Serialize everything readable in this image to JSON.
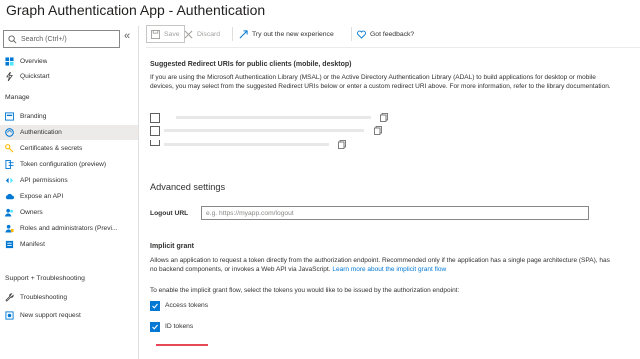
{
  "app": {
    "title": "Graph Authentication App - Authentication"
  },
  "sidebar": {
    "search_placeholder": "Search (Ctrl+/)",
    "collapse_glyph": "«",
    "top_items": [
      {
        "label": "Overview",
        "icon": "grid-icon"
      },
      {
        "label": "Quickstart",
        "icon": "lightning-icon"
      }
    ],
    "manage_heading": "Manage",
    "manage_items": [
      {
        "label": "Branding",
        "icon": "branding-icon"
      },
      {
        "label": "Authentication",
        "icon": "auth-icon",
        "active": true
      },
      {
        "label": "Certificates & secrets",
        "icon": "key-icon"
      },
      {
        "label": "Token configuration (preview)",
        "icon": "token-icon"
      },
      {
        "label": "API permissions",
        "icon": "api-permissions-icon"
      },
      {
        "label": "Expose an API",
        "icon": "cloud-icon"
      },
      {
        "label": "Owners",
        "icon": "owners-icon"
      },
      {
        "label": "Roles and administrators (Previ...",
        "icon": "roles-icon"
      },
      {
        "label": "Manifest",
        "icon": "manifest-icon"
      }
    ],
    "support_heading": "Support + Troubleshooting",
    "support_items": [
      {
        "label": "Troubleshooting",
        "icon": "wrench-icon"
      },
      {
        "label": "New support request",
        "icon": "support-icon"
      }
    ]
  },
  "toolbar": {
    "save_label": "Save",
    "discard_label": "Discard",
    "try_label": "Try out the new experience",
    "feedback_label": "Got feedback?"
  },
  "redirect": {
    "heading": "Suggested Redirect URIs for public clients (mobile, desktop)",
    "description": "If you are using the Microsoft Authentication Library (MSAL) or the Active Directory Authentication Library (ADAL) to build applications for desktop or mobile devices, you may select from the suggested Redirect URIs below or enter a custom redirect URI above. For more information, refer to the library documentation.",
    "uris": [
      {
        "checked": false
      },
      {
        "checked": false
      },
      {
        "checked": false
      }
    ]
  },
  "advanced": {
    "heading": "Advanced settings",
    "logout_label": "Logout URL",
    "logout_placeholder": "e.g. https://myapp.com/logout",
    "logout_value": ""
  },
  "implicit": {
    "heading": "Implicit grant",
    "description": "Allows an application to request a token directly from the authorization endpoint. Recommended only if the application has a single page architecture (SPA), has no backend components, or invokes a Web API via JavaScript.",
    "learn_more": "Learn more about the implicit grant flow",
    "prompt": "To enable the implicit grant flow, select the tokens you would like to be issued by the authorization endpoint:",
    "access_tokens_label": "Access tokens",
    "access_tokens_checked": true,
    "id_tokens_label": "ID tokens",
    "id_tokens_checked": true
  },
  "colors": {
    "accent": "#0078d4",
    "highlight": "#e74856",
    "active_nav": "#edebe9"
  }
}
